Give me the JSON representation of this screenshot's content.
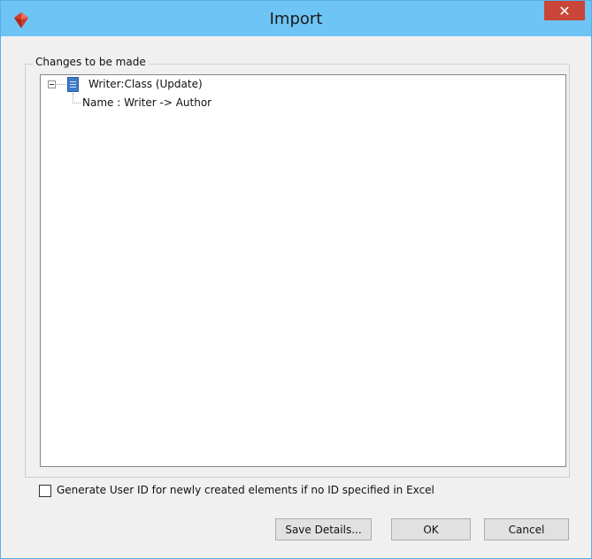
{
  "window": {
    "title": "Import",
    "close_symbol": "✕"
  },
  "group": {
    "label": "Changes to be made"
  },
  "tree": {
    "items": [
      {
        "label": "Writer:Class (Update)"
      },
      {
        "label": "Name : Writer -> Author"
      }
    ]
  },
  "options": {
    "generate_id_label": "Generate User ID for newly created elements if no ID specified in Excel",
    "generate_id_checked": false
  },
  "buttons": {
    "save_details": "Save Details...",
    "ok": "OK",
    "cancel": "Cancel"
  },
  "colors": {
    "titlebar": "#6ec4f4",
    "close": "#c94537",
    "class_icon": "#3d7bc9"
  },
  "icons": {
    "app": "vp-app-icon",
    "class": "class-icon"
  }
}
